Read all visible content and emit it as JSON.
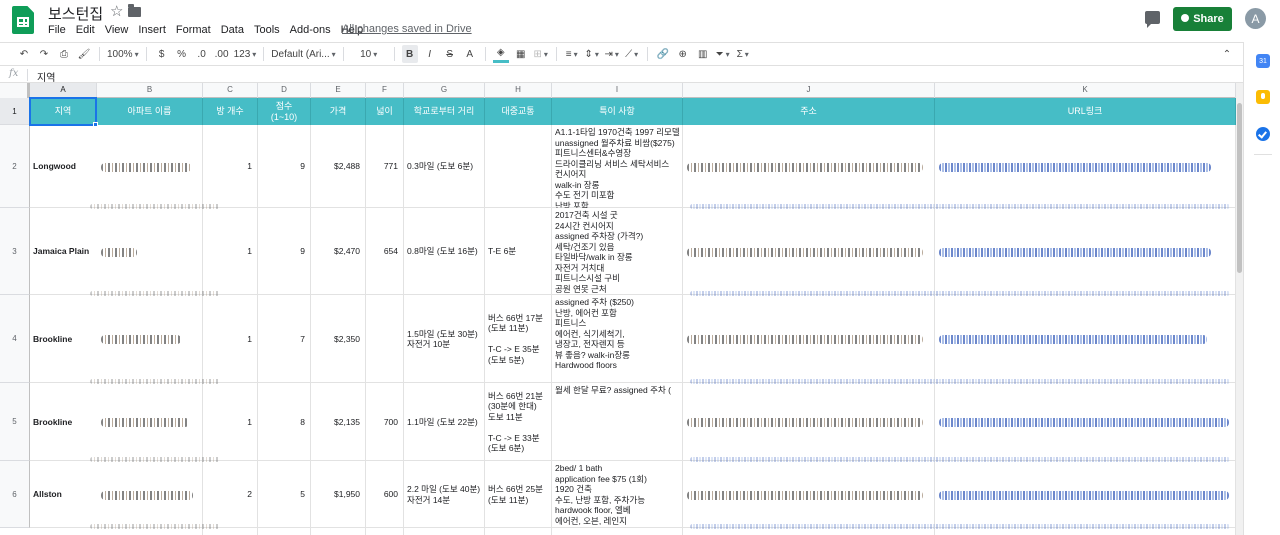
{
  "header": {
    "doc_title": "보스턴집",
    "saved_status": "All changes saved in Drive",
    "share_label": "Share",
    "avatar_initial": "A"
  },
  "menu": [
    "File",
    "Edit",
    "View",
    "Insert",
    "Format",
    "Data",
    "Tools",
    "Add-ons",
    "Help"
  ],
  "toolbar": {
    "zoom": "100%",
    "currency": "$",
    "percent": "%",
    "decrease_decimal": ".0",
    "increase_decimal": ".00",
    "more_formats": "123",
    "font": "Default (Ari...",
    "font_size": "10",
    "bold": "B",
    "italic": "I",
    "strikethrough": "S",
    "text_color": "A",
    "fill_color_hex": "#46bdc6"
  },
  "formula_bar": {
    "fx_label": "fx",
    "cell_value": "지역"
  },
  "columns": [
    "A",
    "B",
    "C",
    "D",
    "E",
    "F",
    "G",
    "H",
    "I",
    "J",
    "K"
  ],
  "rows": [
    "1",
    "2",
    "3",
    "4",
    "5",
    "6"
  ],
  "header_row": [
    "지역",
    "아파트 이름",
    "방 개수",
    "점수\n(1~10)",
    "가격",
    "넓이",
    "학교로부터 거리",
    "대중교통",
    "특이 사항",
    "주소",
    "URL링크"
  ],
  "header_fill_hex": "#46bdc6",
  "data_rows": [
    {
      "region": "Longwood",
      "rooms": "1",
      "score": "9",
      "price": "$2,488",
      "area": "771",
      "distance": "0.3마일 (도보 6분)",
      "transit": "",
      "notes": "A1.1-1타입 1970건축 1997 리모델\nunassigned 월주차료 비쌈($275)\n피트니스센터&수영장\n드라이클리닝 서비스 세탁서비스\n컨시어지\nwalk-in 장롱\n수도 전기 미포함\n난방 포함"
    },
    {
      "region": "Jamaica Plain",
      "rooms": "1",
      "score": "9",
      "price": "$2,470",
      "area": "654",
      "distance": "0.8마일 (도보 16분)",
      "transit": "T-E 6분",
      "notes": "2017건축 시설 굿\n24시간 컨시어지\nassigned 주차장 (가격?)\n세탁/건조기 있음\n타일바닥/walk in 장롱\n자전거 거치대\n피트니스시설 구비\n공원 연못 근처"
    },
    {
      "region": "Brookline",
      "rooms": "1",
      "score": "7",
      "price": "$2,350",
      "area": "",
      "distance": "1.5마일 (도보 30분)\n자전거 10분",
      "transit": "버스 66번 17분\n(도보 11분)\n\nT-C -> E 35분\n(도보 5분)",
      "notes": "assigned 주차 ($250)\n난방, 에어컨 포함\n피트니스\n에어컨, 식기세척기,\n냉장고, 전자렌지 등\n뷰 좋음? walk-in장롱\nHardwood floors"
    },
    {
      "region": "Brookline",
      "rooms": "1",
      "score": "8",
      "price": "$2,135",
      "area": "700",
      "distance": "1.1마일 (도보 22분)",
      "transit": "버스 66번 21분\n(30분에 한대)\n도보 11분\n\nT-C -> E 33분\n(도보 6분)",
      "notes": "월세 한달 무료? assigned 주차 ("
    },
    {
      "region": "Allston",
      "rooms": "2",
      "score": "5",
      "price": "$1,950",
      "area": "600",
      "distance": "2.2 마일 (도보 40분)\n자전거 14분",
      "transit": "버스 66번 25분\n(도보 11분)",
      "notes": "2bed/ 1 bath\napplication fee $75 (1회)\n1920 건축\n수도, 난방 포함, 주차가능\nhardwook floor, 엘베\n에어컨, 오븐, 레인지\n\n흡연가능 (단점)"
    }
  ],
  "side_panel": {
    "calendar_day": "31"
  }
}
